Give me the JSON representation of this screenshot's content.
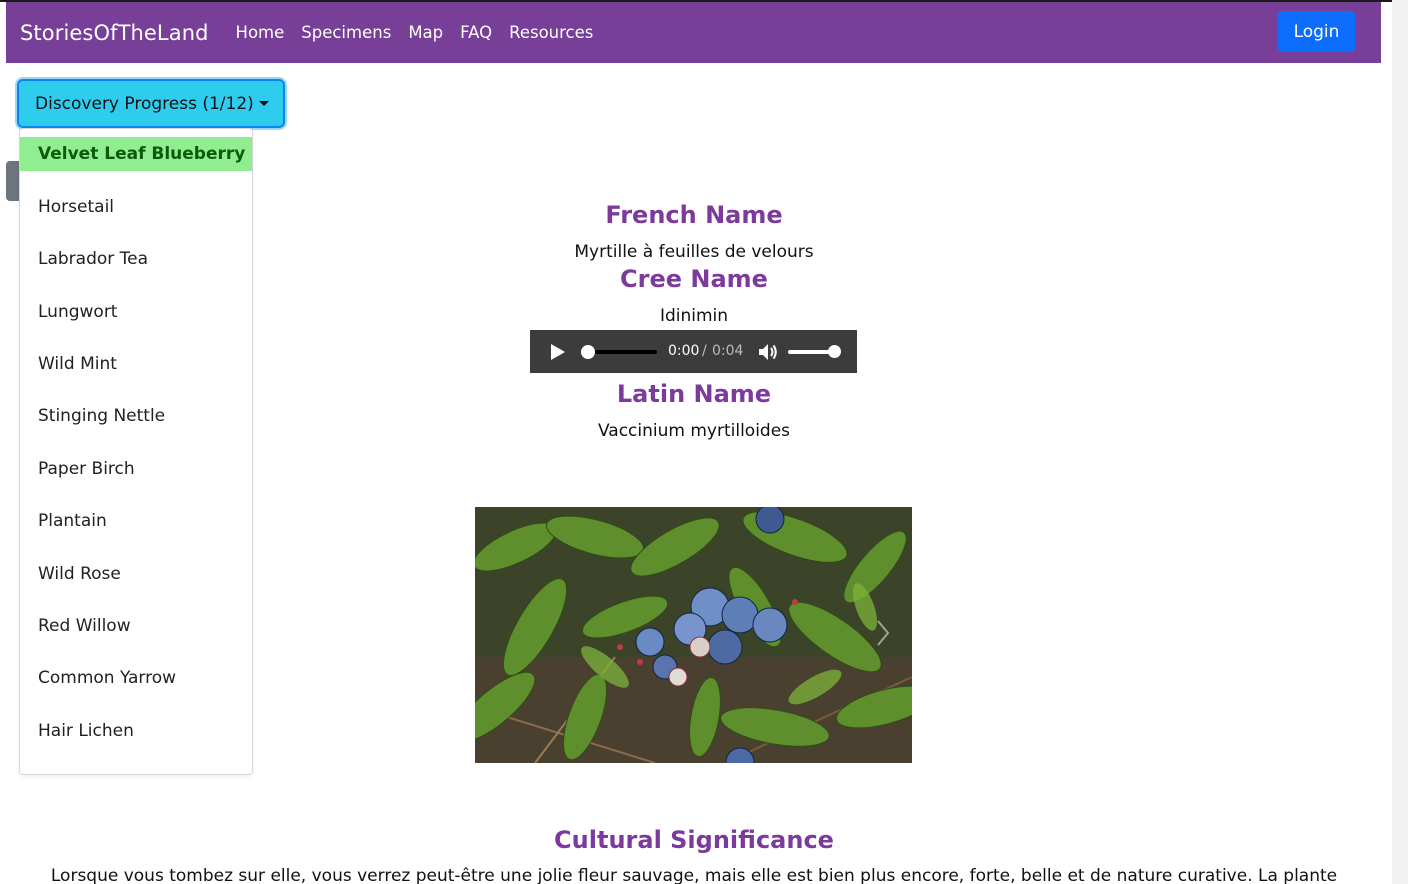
{
  "navbar": {
    "brand": "StoriesOfTheLand",
    "links": [
      "Home",
      "Specimens",
      "Map",
      "FAQ",
      "Resources"
    ],
    "login": "Login",
    "color": "#783f99"
  },
  "progress": {
    "label": "Discovery Progress (1/12)",
    "items": [
      "Velvet Leaf Blueberry",
      "Horsetail",
      "Labrador Tea",
      "Lungwort",
      "Wild Mint",
      "Stinging Nettle",
      "Paper Birch",
      "Plantain",
      "Wild Rose",
      "Red Willow",
      "Common Yarrow",
      "Hair Lichen"
    ],
    "active_index": 0
  },
  "specimen": {
    "french_heading": "French Name",
    "french_value": "Myrtille à feuilles de velours",
    "cree_heading": "Cree Name",
    "cree_value": "Idinimin",
    "latin_heading": "Latin Name",
    "latin_value": "Vaccinium myrtilloides",
    "image_alt": "velvet leaf blueberry plant with blue berries",
    "cultural_heading": "Cultural Significance",
    "cultural_text": "Lorsque vous tombez sur elle, vous verrez peut-être une jolie fleur sauvage, mais elle est bien plus encore, forte, belle et de nature curative. La plante"
  },
  "audio": {
    "current": "0:00",
    "separator": "/",
    "duration": "0:04",
    "volume": 1.0
  },
  "colors": {
    "heading": "#7b3a9c",
    "progress_button": "#2ecdf0",
    "active_item": "#90ee90",
    "login": "#0d6efd"
  }
}
